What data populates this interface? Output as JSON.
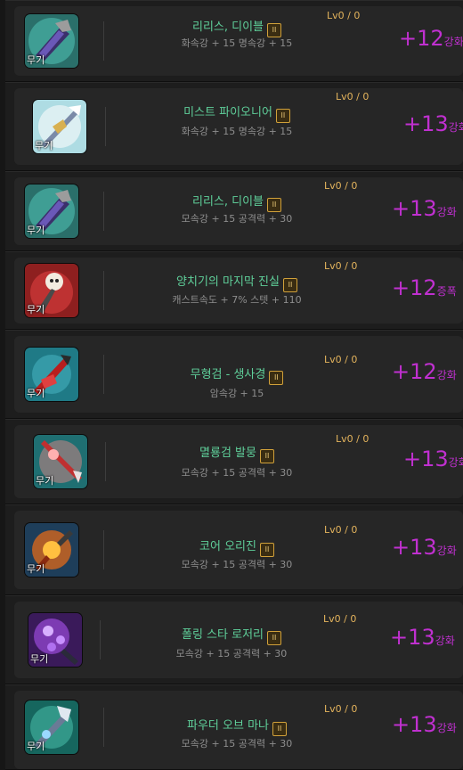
{
  "items": [
    {
      "name": "리리스, 디이블",
      "tier": "II",
      "stats": "화속강 + 15 명속강 + 15",
      "level": "Lv0 / 0",
      "enhance": "+12",
      "enhance_type": "강화",
      "category": "무기",
      "icon": "dark-claw-weapon-icon"
    },
    {
      "name": "미스트 파이오니어",
      "tier": "II",
      "stats": "화속강 + 15 명속강 + 15",
      "level": "Lv0 / 0",
      "enhance": "+13",
      "enhance_type": "강화",
      "category": "무기",
      "icon": "mist-pioneer-weapon-icon"
    },
    {
      "name": "리리스, 디이블",
      "tier": "II",
      "stats": "모속강 + 15 공격력 + 30",
      "level": "Lv0 / 0",
      "enhance": "+13",
      "enhance_type": "강화",
      "category": "무기",
      "icon": "dark-claw-weapon-icon"
    },
    {
      "name": "양치기의 마지막 진실",
      "tier": "II",
      "stats": "캐스트속도 + 7% 스텟 + 110",
      "level": "Lv0 / 0",
      "enhance": "+12",
      "enhance_type": "증폭",
      "category": "무기",
      "icon": "shepherd-weapon-icon"
    },
    {
      "name": "무형검 - 생사경",
      "tier": "II",
      "stats": "암속강 + 15",
      "level": "Lv0 / 0",
      "enhance": "+12",
      "enhance_type": "강화",
      "category": "무기",
      "icon": "formless-sword-icon"
    },
    {
      "name": "멸룡검 발뭉",
      "tier": "II",
      "stats": "모속강 + 15 공격력 + 30",
      "level": "Lv0 / 0",
      "enhance": "+13",
      "enhance_type": "강화",
      "category": "무기",
      "icon": "dragon-slayer-sword-icon"
    },
    {
      "name": "코어 오리진",
      "tier": "II",
      "stats": "모속강 + 15 공격력 + 30",
      "level": "Lv0 / 0",
      "enhance": "+13",
      "enhance_type": "강화",
      "category": "무기",
      "icon": "core-origin-weapon-icon"
    },
    {
      "name": "폴링 스타 로저리",
      "tier": "II",
      "stats": "모속강 + 15 공격력 + 30",
      "level": "Lv0 / 0",
      "enhance": "+13",
      "enhance_type": "강화",
      "category": "무기",
      "icon": "falling-star-rosary-icon"
    },
    {
      "name": "파우더 오브 마나",
      "tier": "II",
      "stats": "모속강 + 15 공격력 + 30",
      "level": "Lv0 / 0",
      "enhance": "+13",
      "enhance_type": "강화",
      "category": "무기",
      "icon": "powder-of-mana-weapon-icon"
    }
  ],
  "colors": {
    "name": "#5fcf9a",
    "level": "#e3b35c",
    "enhance": "#c030d0",
    "stats": "#8e8e8e"
  }
}
